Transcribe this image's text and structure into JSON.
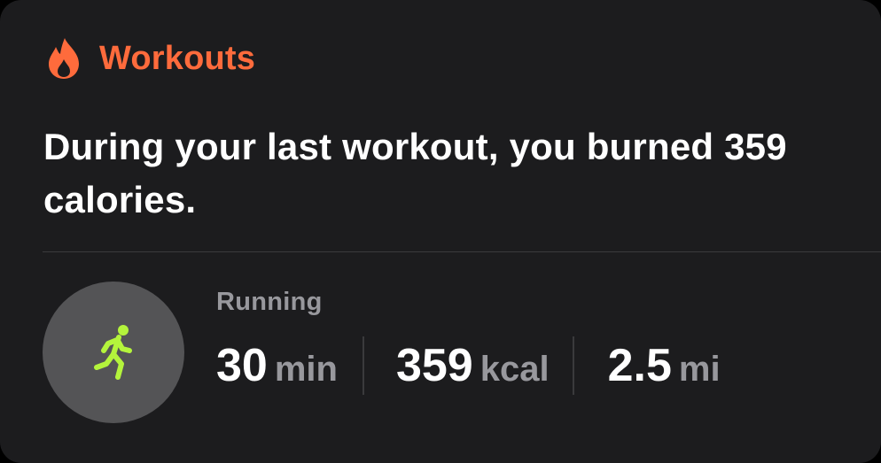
{
  "header": {
    "icon": "flame-icon",
    "title": "Workouts",
    "accent_color": "#fe6b3c"
  },
  "summary": {
    "text": "During your last workout, you burned 359 calories."
  },
  "workout": {
    "icon": "running-figure-icon",
    "icon_color": "#b4f43c",
    "type": "Running",
    "stats": [
      {
        "value": "30",
        "unit": "min"
      },
      {
        "value": "359",
        "unit": "kcal"
      },
      {
        "value": "2.5",
        "unit": "mi"
      }
    ]
  }
}
